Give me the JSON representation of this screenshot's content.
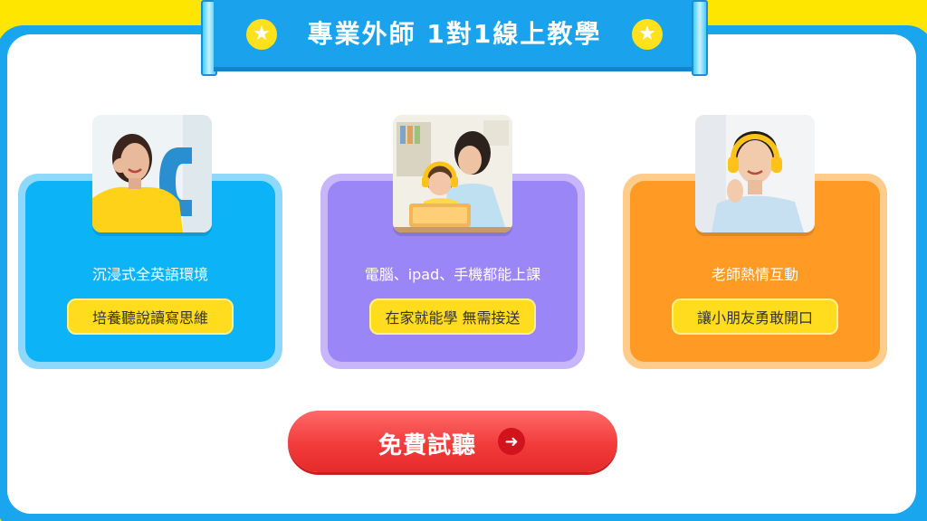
{
  "banner": {
    "title": "專業外師 1對1線上教學",
    "star_icon": "★"
  },
  "cards": [
    {
      "caption": "沉浸式全英語環境",
      "pill": "培養聽說讀寫思維",
      "color": "#0cb3f6"
    },
    {
      "caption": "電腦、ipad、手機都能上課",
      "pill": "在家就能學 無需接送",
      "color": "#9a86f6"
    },
    {
      "caption": "老師熱情互動",
      "pill": "讓小朋友勇敢開口",
      "color": "#ff9b24"
    }
  ],
  "cta": {
    "label": "免費試聽",
    "arrow": "➜",
    "color": "#f23b3b"
  },
  "colors": {
    "frame": "#1aa6ef",
    "background": "#ffe600",
    "pill": "#ffdc1e"
  }
}
